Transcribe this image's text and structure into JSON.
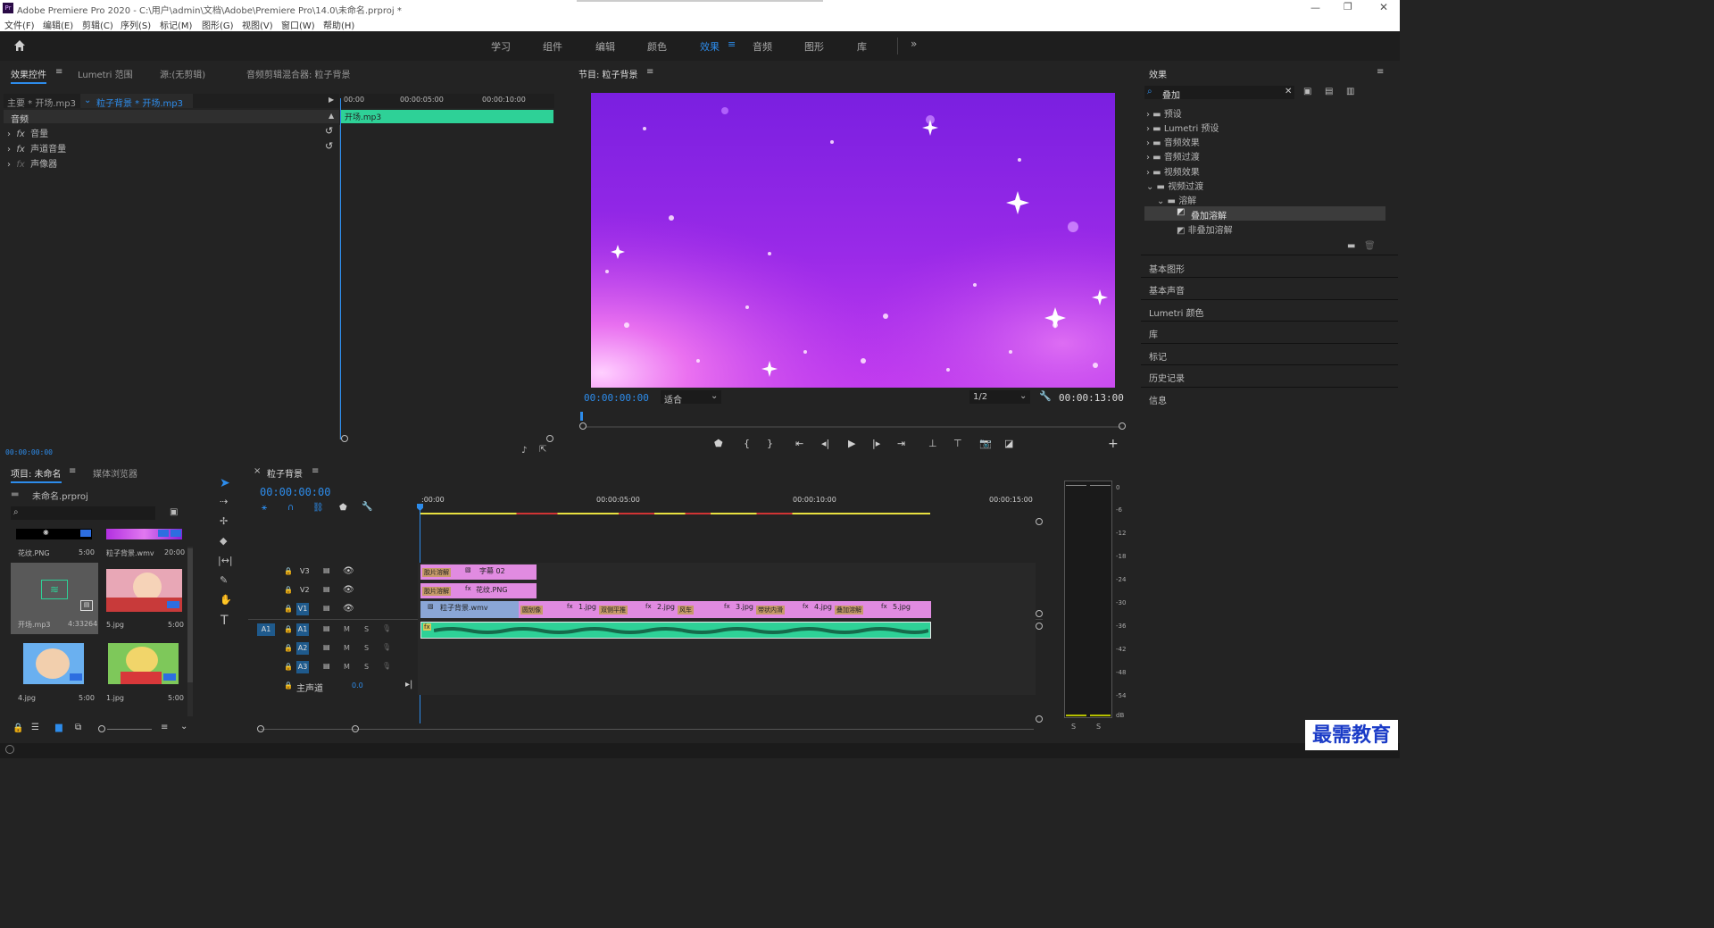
{
  "app": {
    "title": "Adobe Premiere Pro 2020 - C:\\用户\\admin\\文档\\Adobe\\Premiere Pro\\14.0\\未命名.prproj *",
    "icon": "Pr"
  },
  "menu": [
    "文件(F)",
    "编辑(E)",
    "剪辑(C)",
    "序列(S)",
    "标记(M)",
    "图形(G)",
    "视图(V)",
    "窗口(W)",
    "帮助(H)"
  ],
  "workspaces": [
    "学习",
    "组件",
    "编辑",
    "颜色",
    "效果",
    "音频",
    "图形",
    "库"
  ],
  "active_workspace": "效果",
  "effect_controls": {
    "tabs": [
      "效果控件",
      "Lumetri 范围",
      "源:(无剪辑)",
      "音频剪辑混合器: 粒子背景"
    ],
    "master": "主要 * 开场.mp3",
    "clip": "粒子背景 * 开场.mp3",
    "section": "音频",
    "rows": [
      "音量",
      "声道音量",
      "声像器"
    ],
    "ruler": [
      "00:00",
      "00:00:05:00",
      "00:00:10:00"
    ],
    "clip_bar": "开场.mp3",
    "timecode": "00:00:00:00"
  },
  "program": {
    "title": "节目: 粒子背景",
    "timecode": "00:00:00:00",
    "fit": "适合",
    "quality": "1/2",
    "duration": "00:00:13:00"
  },
  "effects": {
    "title": "效果",
    "search": "叠加",
    "tree": [
      {
        "label": "预设",
        "level": 0
      },
      {
        "label": "Lumetri 预设",
        "level": 0
      },
      {
        "label": "音频效果",
        "level": 0
      },
      {
        "label": "音频过渡",
        "level": 0
      },
      {
        "label": "视频效果",
        "level": 0
      },
      {
        "label": "视频过渡",
        "level": 0
      },
      {
        "label": "溶解",
        "level": 1
      },
      {
        "label": "叠加溶解",
        "level": 2
      },
      {
        "label": "非叠加溶解",
        "level": 2
      }
    ],
    "panels": [
      "基本图形",
      "基本声音",
      "Lumetri 颜色",
      "库",
      "标记",
      "历史记录",
      "信息"
    ]
  },
  "project": {
    "tabs": [
      "项目: 未命名",
      "媒体浏览器"
    ],
    "file": "未命名.prproj",
    "items": [
      {
        "name": "花纹.PNG",
        "dur": "5:00"
      },
      {
        "name": "粒子背景.wmv",
        "dur": "20:00"
      },
      {
        "name": "开场.mp3",
        "dur": "4:33264"
      },
      {
        "name": "5.jpg",
        "dur": "5:00"
      },
      {
        "name": "4.jpg",
        "dur": "5:00"
      },
      {
        "name": "1.jpg",
        "dur": "5:00"
      }
    ]
  },
  "timeline": {
    "title": "粒子背景",
    "timecode": "00:00:00:00",
    "ruler": [
      ":00:00",
      "00:00:05:00",
      "00:00:10:00",
      "00:00:15:00"
    ],
    "tracks": [
      "V3",
      "V2",
      "V1",
      "A1",
      "A2",
      "A3"
    ],
    "master": "主声道",
    "master_val": "0.0",
    "source_patch": "A1",
    "v3": [
      {
        "t": "胶片溶解"
      },
      {
        "t": "字幕 02"
      }
    ],
    "v2": [
      {
        "t": "胶片溶解"
      },
      {
        "t": "花纹.PNG"
      }
    ],
    "v1": [
      "粒子背景.wmv",
      "圆划像",
      "1.jpg",
      "双侧平推",
      "2.jpg",
      "风车",
      "3.jpg",
      "带状内滑",
      "4.jpg",
      "叠加溶解",
      "5.jpg"
    ]
  },
  "meter": {
    "scale": [
      "0",
      "-6",
      "-12",
      "-18",
      "-24",
      "-30",
      "-36",
      "-42",
      "-48",
      "-54",
      "dB"
    ],
    "solo": [
      "S",
      "S"
    ]
  },
  "watermark": "最需教育",
  "colors": {
    "accent": "#2d8ceb",
    "audio_clip": "#2ed197",
    "video_clip": "#e18be1",
    "v1_clip": "#8aa6d6"
  }
}
